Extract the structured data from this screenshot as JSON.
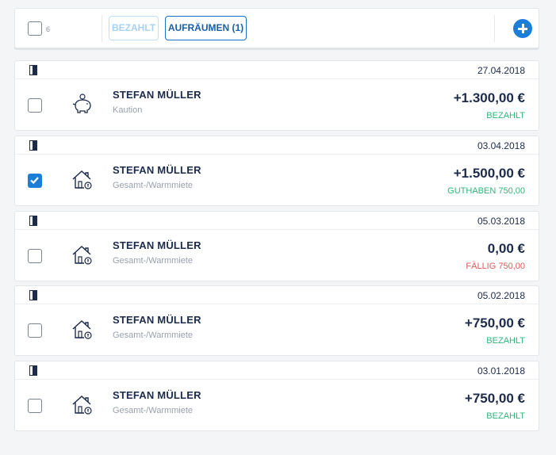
{
  "toolbar": {
    "count": "6",
    "paid_label": "BEZAHLT",
    "cleanup_label": "AUFRÄUMEN (1)"
  },
  "colors": {
    "accent": "#1c7ed6",
    "status_paid": "#2fb67a",
    "status_credit": "#2fb67a",
    "status_due": "#e05a5a"
  },
  "transactions": [
    {
      "date": "27.04.2018",
      "name": "STEFAN MÜLLER",
      "category": "Kaution",
      "amount": "+1.300,00 €",
      "status": "BEZAHLT",
      "status_type": "paid",
      "icon": "piggy-bank-icon",
      "checked": false
    },
    {
      "date": "03.04.2018",
      "name": "STEFAN MÜLLER",
      "category": "Gesamt-/Warmmiete",
      "amount": "+1.500,00 €",
      "status": "GUTHABEN 750,00",
      "status_type": "credit",
      "icon": "house-rent-icon",
      "checked": true
    },
    {
      "date": "05.03.2018",
      "name": "STEFAN MÜLLER",
      "category": "Gesamt-/Warmmiete",
      "amount": "0,00 €",
      "status": "FÄLLIG 750,00",
      "status_type": "due",
      "icon": "house-rent-icon",
      "checked": false
    },
    {
      "date": "05.02.2018",
      "name": "STEFAN MÜLLER",
      "category": "Gesamt-/Warmmiete",
      "amount": "+750,00 €",
      "status": "BEZAHLT",
      "status_type": "paid",
      "icon": "house-rent-icon",
      "checked": false
    },
    {
      "date": "03.01.2018",
      "name": "STEFAN MÜLLER",
      "category": "Gesamt-/Warmmiete",
      "amount": "+750,00 €",
      "status": "BEZAHLT",
      "status_type": "paid",
      "icon": "house-rent-icon",
      "checked": false
    }
  ]
}
